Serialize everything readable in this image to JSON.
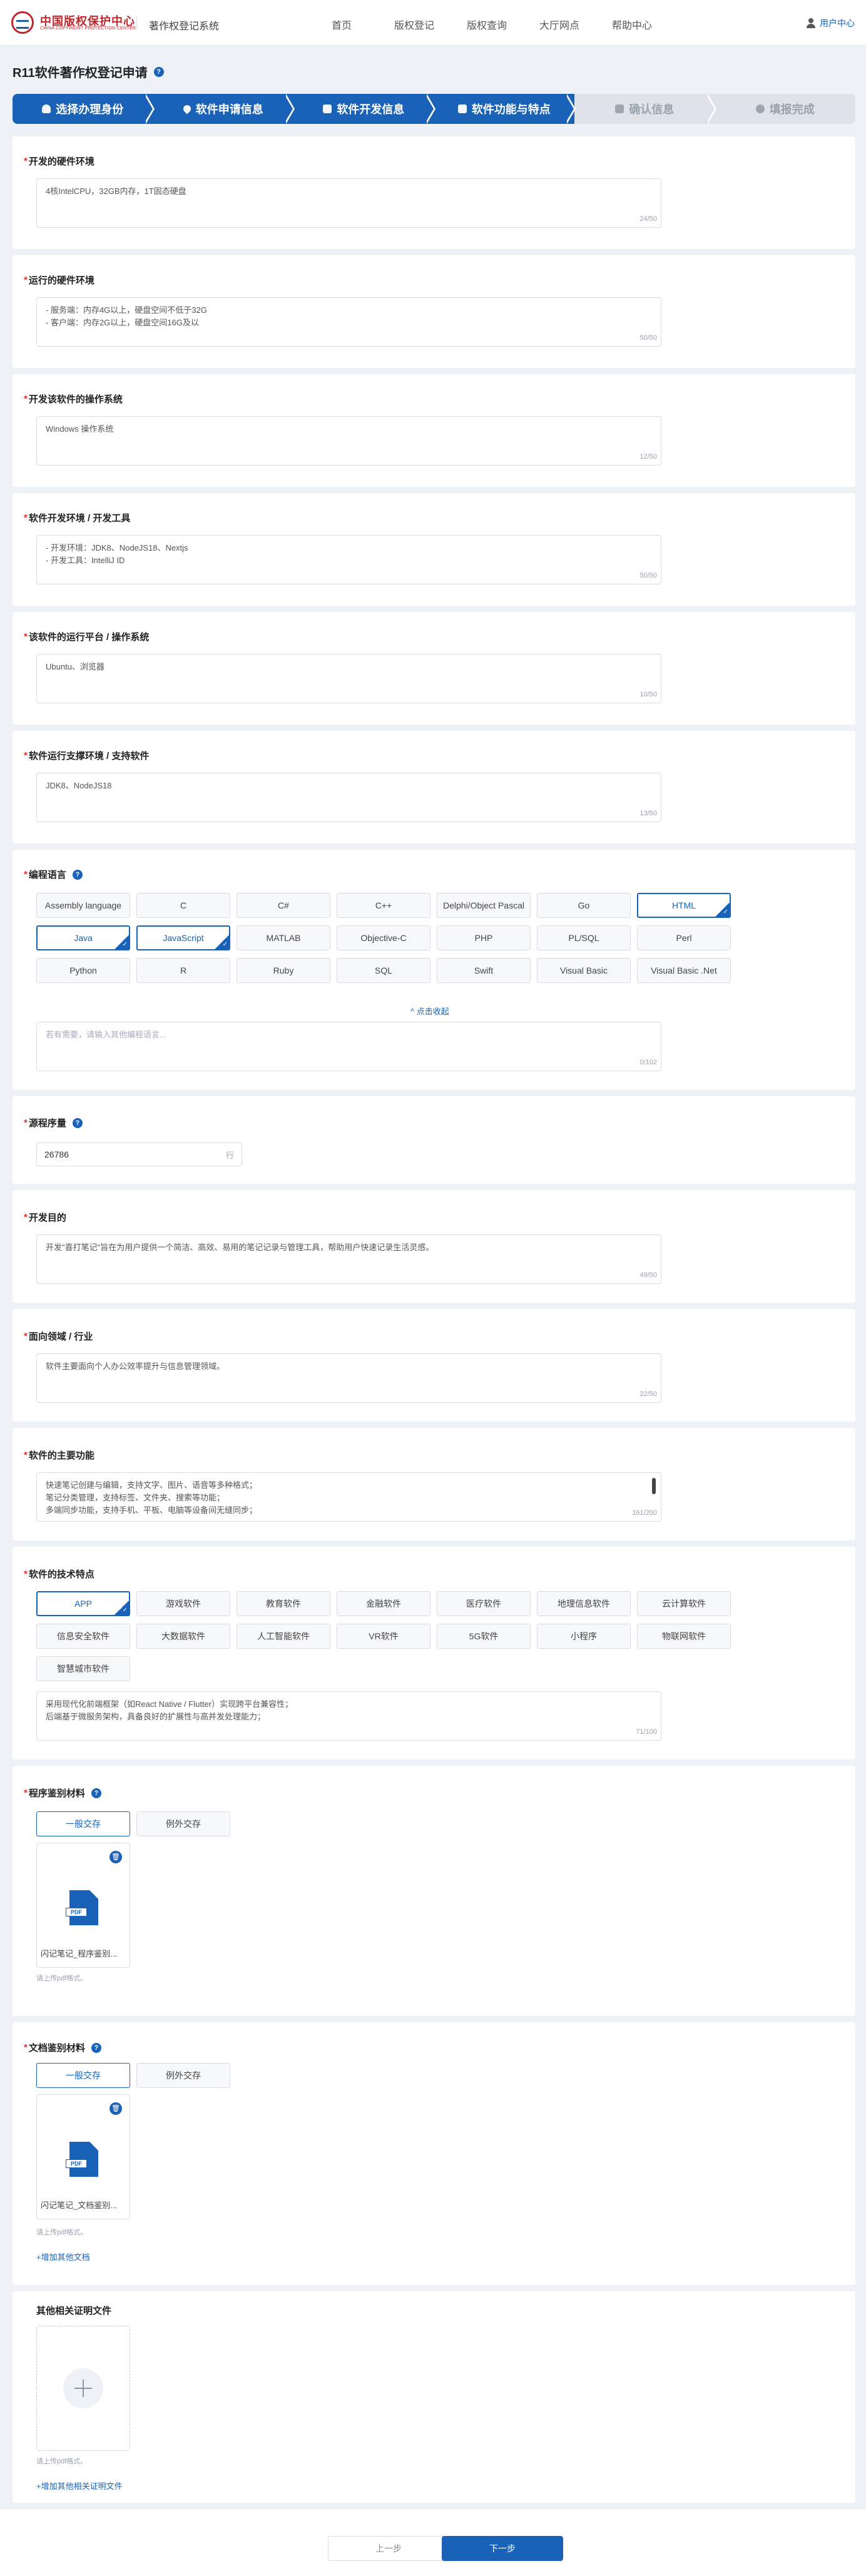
{
  "header": {
    "logo_cn": "中国版权保护中心",
    "logo_en": "CHINA COPYRIGHT PROTECTION CENTER",
    "system_name": "著作权登记系统",
    "nav": [
      "首页",
      "版权登记",
      "版权查询",
      "大厅网点",
      "帮助中心"
    ],
    "user_center": "用户中心"
  },
  "page": {
    "title": "R11软件著作权登记申请",
    "help_icon": "?"
  },
  "steps": [
    {
      "label": "选择办理身份",
      "active": true,
      "icon": "person-icon"
    },
    {
      "label": "软件申请信息",
      "active": true,
      "icon": "location-icon"
    },
    {
      "label": "软件开发信息",
      "active": true,
      "icon": "calendar-icon"
    },
    {
      "label": "软件功能与特点",
      "active": true,
      "icon": "document-icon"
    },
    {
      "label": "确认信息",
      "active": false,
      "icon": "print-icon"
    },
    {
      "label": "填报完成",
      "active": false,
      "icon": "check-circle-icon"
    }
  ],
  "sections": {
    "dev_hw": {
      "label": "开发的硬件环境",
      "value": "4核IntelCPU，32GB内存，1T固态硬盘",
      "count": "24/50"
    },
    "run_hw": {
      "label": "运行的硬件环境",
      "value": "- 服务端：内存4G以上，硬盘空间不低于32G\n- 客户端：内存2G以上，硬盘空间16G及以",
      "count": "50/50"
    },
    "dev_os": {
      "label": "开发该软件的操作系统",
      "value": "Windows 操作系统",
      "count": "12/50"
    },
    "dev_tools": {
      "label": "软件开发环境 / 开发工具",
      "value": "- 开发环境：JDK8、NodeJS18、Nextjs\n- 开发工具：IntelliJ ID",
      "count": "50/50"
    },
    "run_platform": {
      "label": "该软件的运行平台 / 操作系统",
      "value": "Ubuntu、浏览器",
      "count": "10/50"
    },
    "support_env": {
      "label": "软件运行支撑环境 / 支持软件",
      "value": "JDK8、NodeJS18",
      "count": "13/50"
    },
    "languages": {
      "label": "编程语言",
      "options": [
        "Assembly language",
        "C",
        "C#",
        "C++",
        "Delphi/Object Pascal",
        "Go",
        "HTML",
        "Java",
        "JavaScript",
        "MATLAB",
        "Objective-C",
        "PHP",
        "PL/SQL",
        "Perl",
        "Python",
        "R",
        "Ruby",
        "SQL",
        "Swift",
        "Visual Basic",
        "Visual Basic .Net"
      ],
      "selected": [
        "HTML",
        "Java",
        "JavaScript"
      ],
      "collapse": "^ 点击收起",
      "other_placeholder": "若有需要，请输入其他编程语言...",
      "count": "0/102"
    },
    "source_lines": {
      "label": "源程序量",
      "value": "26786",
      "unit": "行"
    },
    "purpose": {
      "label": "开发目的",
      "value": "开发\"喜打笔记\"旨在为用户提供一个简洁、高效、易用的笔记记录与管理工具，帮助用户快速记录生活灵感。",
      "count": "49/50"
    },
    "industry": {
      "label": "面向领域 / 行业",
      "value": "软件主要面向个人办公效率提升与信息管理领域。",
      "count": "22/50"
    },
    "main_functions": {
      "label": "软件的主要功能",
      "value": "快速笔记创建与编辑，支持文字、图片、语音等多种格式；\n笔记分类管理，支持标签、文件夹、搜索等功能；\n多端同步功能，支持手机、平板、电脑等设备间无缝同步；",
      "count": "161/200"
    },
    "tech_features": {
      "label": "软件的技术特点",
      "options": [
        "APP",
        "游戏软件",
        "教育软件",
        "金融软件",
        "医疗软件",
        "地理信息软件",
        "云计算软件",
        "信息安全软件",
        "大数据软件",
        "人工智能软件",
        "VR软件",
        "5G软件",
        "小程序",
        "物联网软件",
        "智慧城市软件"
      ],
      "selected": [
        "APP"
      ],
      "value": "采用现代化前端框架（如React Native / Flutter）实现跨平台兼容性；\n后端基于微服务架构，具备良好的扩展性与高并发处理能力；",
      "count": "71/100"
    },
    "program_material": {
      "label": "程序鉴别材料",
      "tabs": [
        "一般交存",
        "例外交存"
      ],
      "file_name": "闪记笔记_程序鉴别...",
      "file_type": "PDF",
      "hint": "请上传pdf格式。"
    },
    "doc_material": {
      "label": "文档鉴别材料",
      "tabs": [
        "一般交存",
        "例外交存"
      ],
      "file_name": "闪记笔记_文档鉴别...",
      "file_type": "PDF",
      "hint": "请上传pdf格式。",
      "add_link": "+增加其他文档"
    },
    "other_proof": {
      "label": "其他相关证明文件",
      "hint": "请上传pdf格式。",
      "add_link": "+增加其他相关证明文件"
    }
  },
  "footer": {
    "prev": "上一步",
    "next": "下一步"
  },
  "colors": {
    "primary": "#1a62b8",
    "required": "#e0312b",
    "brand_red": "#c0272d"
  }
}
